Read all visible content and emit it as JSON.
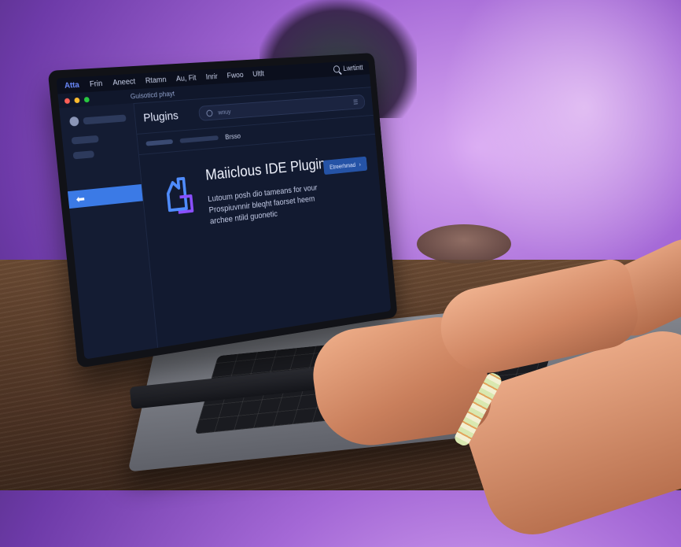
{
  "menubar": {
    "app_name": "Atta",
    "items": [
      "Frin",
      "Aneect",
      "Rtamn",
      "Au, Fit",
      "Inrir",
      "Fwoo",
      "Ultlt"
    ],
    "search_label": "Lwrtintt"
  },
  "window": {
    "title": "Guisoticd phayt"
  },
  "main": {
    "title": "Plugins",
    "search_placeholder": "wnuy",
    "tab_label": "Brsso"
  },
  "plugin": {
    "name": "Maiiclous IDE Plugin",
    "description": "Lutoum posh dio tameans for vour Prospiuvnnir bleqht faorset heem archee ntild guonetic",
    "install_label": "Etreerhmad"
  },
  "colors": {
    "accent": "#3b7ae6",
    "background": "#0f1424",
    "wall": "#a468d6"
  }
}
